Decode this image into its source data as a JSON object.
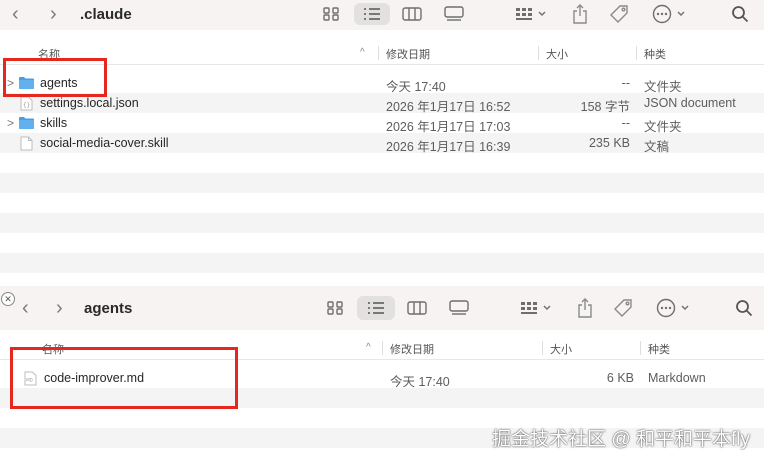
{
  "window1": {
    "title": ".claude",
    "back": "‹",
    "forward": "›",
    "columns": {
      "name": "名称",
      "date": "修改日期",
      "size": "大小",
      "kind": "种类"
    },
    "rows": [
      {
        "name": "agents",
        "date": "今天 17:40",
        "size": "--",
        "kind": "文件夹",
        "icon": "folder-icon",
        "expandable": true
      },
      {
        "name": "settings.local.json",
        "date": "2026 年1月17日 16:52",
        "size": "158 字节",
        "kind": "JSON document",
        "icon": "json-file-icon",
        "expandable": false
      },
      {
        "name": "skills",
        "date": "2026 年1月17日 17:03",
        "size": "--",
        "kind": "文件夹",
        "icon": "folder-icon",
        "expandable": true
      },
      {
        "name": "social-media-cover.skill",
        "date": "2026 年1月17日 16:39",
        "size": "235 KB",
        "kind": "文稿",
        "icon": "document-icon",
        "expandable": false
      }
    ]
  },
  "window2": {
    "title": "agents",
    "back": "‹",
    "forward": "›",
    "columns": {
      "name": "名称",
      "date": "修改日期",
      "size": "大小",
      "kind": "种类"
    },
    "rows": [
      {
        "name": "code-improver.md",
        "date": "今天 17:40",
        "size": "6 KB",
        "kind": "Markdown",
        "icon": "markdown-file-icon"
      }
    ]
  },
  "toolbar_icons": [
    "grid-view-icon",
    "list-view-icon",
    "column-view-icon",
    "gallery-view-icon",
    "group-by-icon",
    "share-icon",
    "tag-icon",
    "more-actions-icon",
    "search-icon"
  ],
  "watermark": "掘金技术社区 @ 和平和平本fly",
  "close_glyph": "✕",
  "sort_glyph": "^",
  "expand_glyph": ">",
  "colors": {
    "highlight_box": "#e5271d",
    "folder": "#4a9de0",
    "toolbar_bg": "#f6f3f2",
    "stripe": "#f4f4f5"
  }
}
